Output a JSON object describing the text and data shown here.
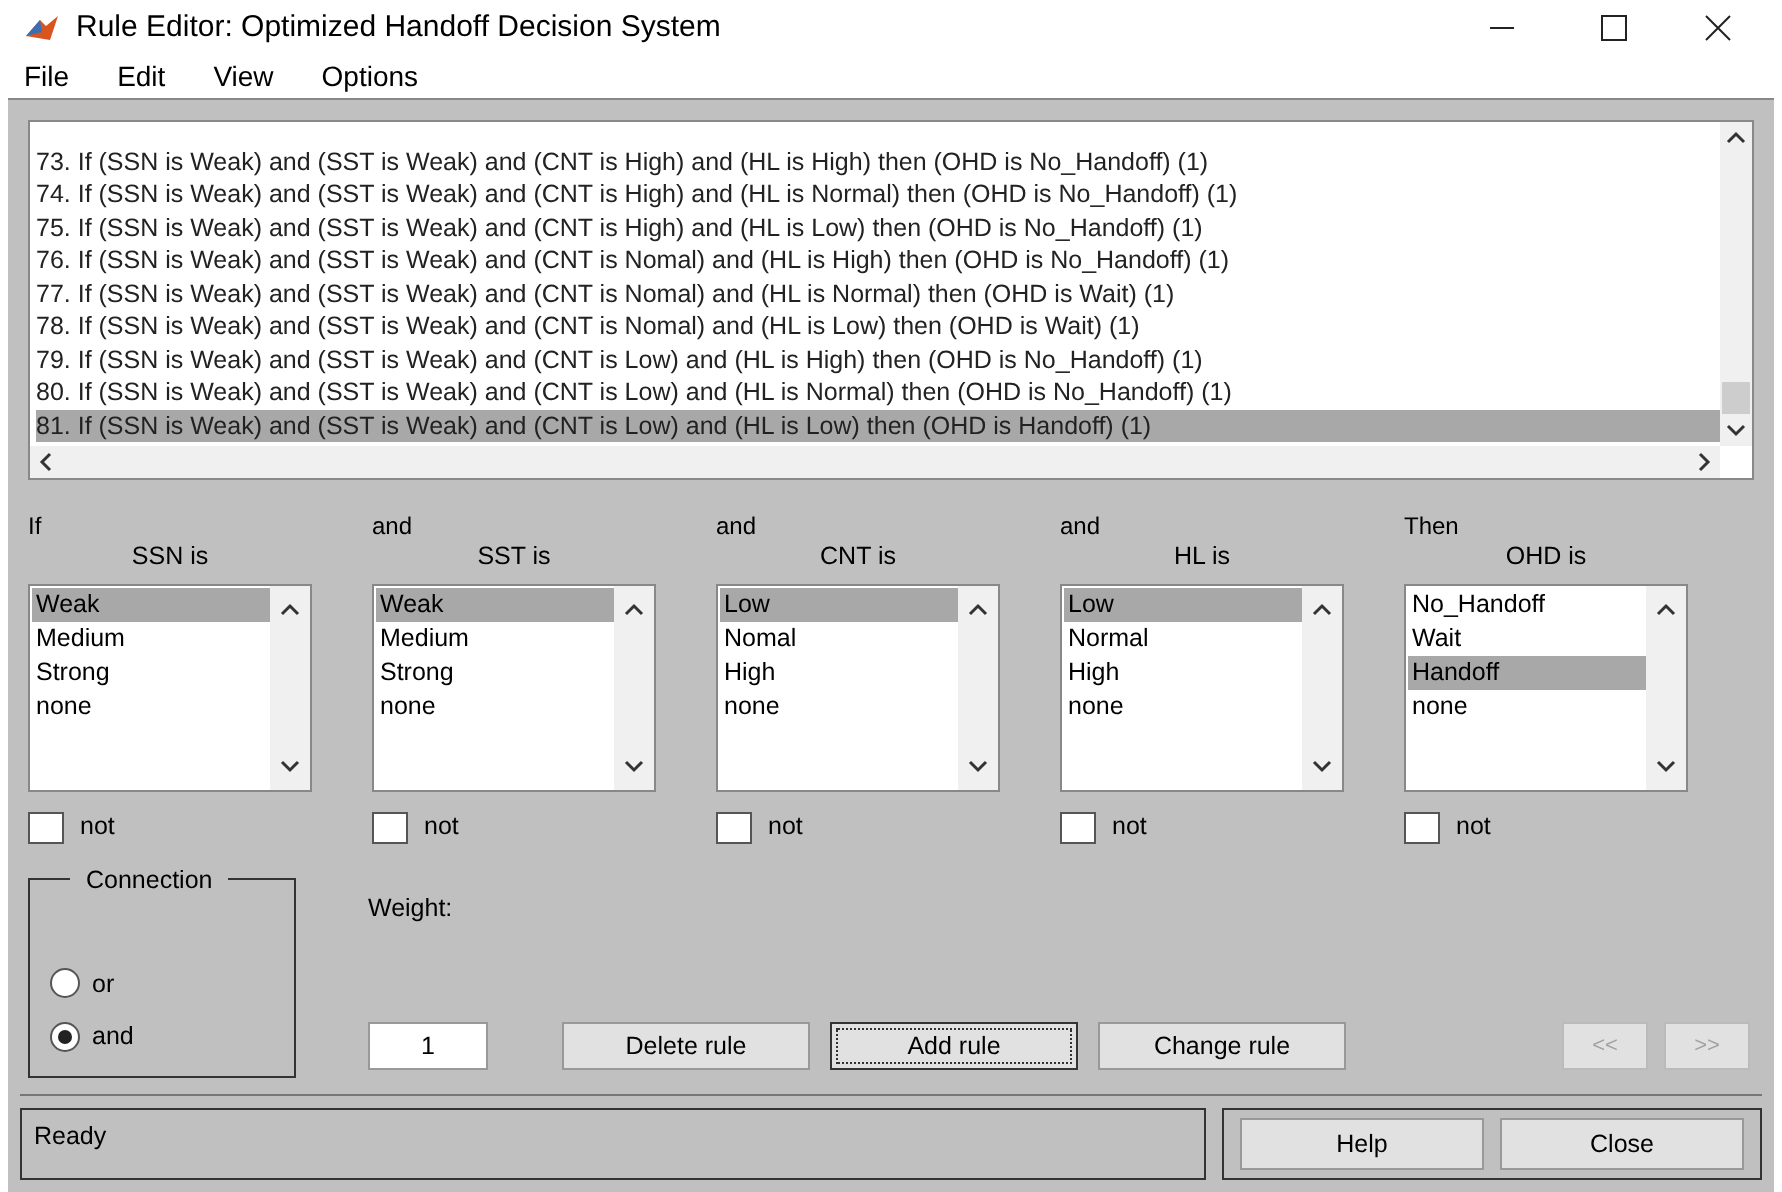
{
  "window": {
    "title": "Rule Editor: Optimized Handoff Decision System"
  },
  "menu": [
    "File",
    "Edit",
    "View",
    "Options"
  ],
  "rules": [
    {
      "text": "73. If (SSN is Weak) and (SST is Weak) and (CNT is High) and (HL is High) then (OHD is No_Handoff) (1)",
      "selected": false
    },
    {
      "text": "74. If (SSN is Weak) and (SST is Weak) and (CNT is High) and (HL is Normal) then (OHD is No_Handoff) (1)",
      "selected": false
    },
    {
      "text": "75. If (SSN is Weak) and (SST is Weak) and (CNT is High) and (HL is Low) then (OHD is No_Handoff) (1)",
      "selected": false
    },
    {
      "text": "76. If (SSN is Weak) and (SST is Weak) and (CNT is Nomal) and (HL is High) then (OHD is No_Handoff) (1)",
      "selected": false
    },
    {
      "text": "77. If (SSN is Weak) and (SST is Weak) and (CNT is Nomal) and (HL is Normal) then (OHD is Wait) (1)",
      "selected": false
    },
    {
      "text": "78. If (SSN is Weak) and (SST is Weak) and (CNT is Nomal) and (HL is Low) then (OHD is Wait) (1)",
      "selected": false
    },
    {
      "text": "79. If (SSN is Weak) and (SST is Weak) and (CNT is Low) and (HL is High) then (OHD is No_Handoff) (1)",
      "selected": false
    },
    {
      "text": "80. If (SSN is Weak) and (SST is Weak) and (CNT is Low) and (HL is Normal) then (OHD is No_Handoff) (1)",
      "selected": false
    },
    {
      "text": "81. If (SSN is Weak) and (SST is Weak) and (CNT is Low) and (HL is Low) then (OHD is Handoff) (1)",
      "selected": true
    }
  ],
  "variables": [
    {
      "connector": "If",
      "title": "SSN is",
      "not_label": "not",
      "not_checked": false,
      "options": [
        {
          "label": "Weak",
          "selected": true
        },
        {
          "label": "Medium",
          "selected": false
        },
        {
          "label": "Strong",
          "selected": false
        },
        {
          "label": "none",
          "selected": false
        }
      ]
    },
    {
      "connector": "and",
      "title": "SST is",
      "not_label": "not",
      "not_checked": false,
      "options": [
        {
          "label": "Weak",
          "selected": true
        },
        {
          "label": "Medium",
          "selected": false
        },
        {
          "label": "Strong",
          "selected": false
        },
        {
          "label": "none",
          "selected": false
        }
      ]
    },
    {
      "connector": "and",
      "title": "CNT is",
      "not_label": "not",
      "not_checked": false,
      "options": [
        {
          "label": "Low",
          "selected": true
        },
        {
          "label": "Nomal",
          "selected": false
        },
        {
          "label": "High",
          "selected": false
        },
        {
          "label": "none",
          "selected": false
        }
      ]
    },
    {
      "connector": "and",
      "title": "HL is",
      "not_label": "not",
      "not_checked": false,
      "options": [
        {
          "label": "Low",
          "selected": true
        },
        {
          "label": "Normal",
          "selected": false
        },
        {
          "label": "High",
          "selected": false
        },
        {
          "label": "none",
          "selected": false
        }
      ]
    },
    {
      "connector": "Then",
      "title": "OHD is",
      "not_label": "not",
      "not_checked": false,
      "options": [
        {
          "label": "No_Handoff",
          "selected": false
        },
        {
          "label": "Wait",
          "selected": false
        },
        {
          "label": "Handoff",
          "selected": true
        },
        {
          "label": "none",
          "selected": false
        }
      ]
    }
  ],
  "connection": {
    "title": "Connection",
    "options": [
      {
        "label": "or",
        "selected": false
      },
      {
        "label": "and",
        "selected": true
      }
    ]
  },
  "weight": {
    "label": "Weight:",
    "value": "1"
  },
  "rule_buttons": [
    {
      "label": "Delete rule",
      "focused": false
    },
    {
      "label": "Add rule",
      "focused": true
    },
    {
      "label": "Change rule",
      "focused": false
    }
  ],
  "nav_buttons": [
    {
      "label": "<<",
      "disabled": true
    },
    {
      "label": ">>",
      "disabled": true
    }
  ],
  "status": "Ready",
  "footer_buttons": [
    "Help",
    "Close"
  ]
}
